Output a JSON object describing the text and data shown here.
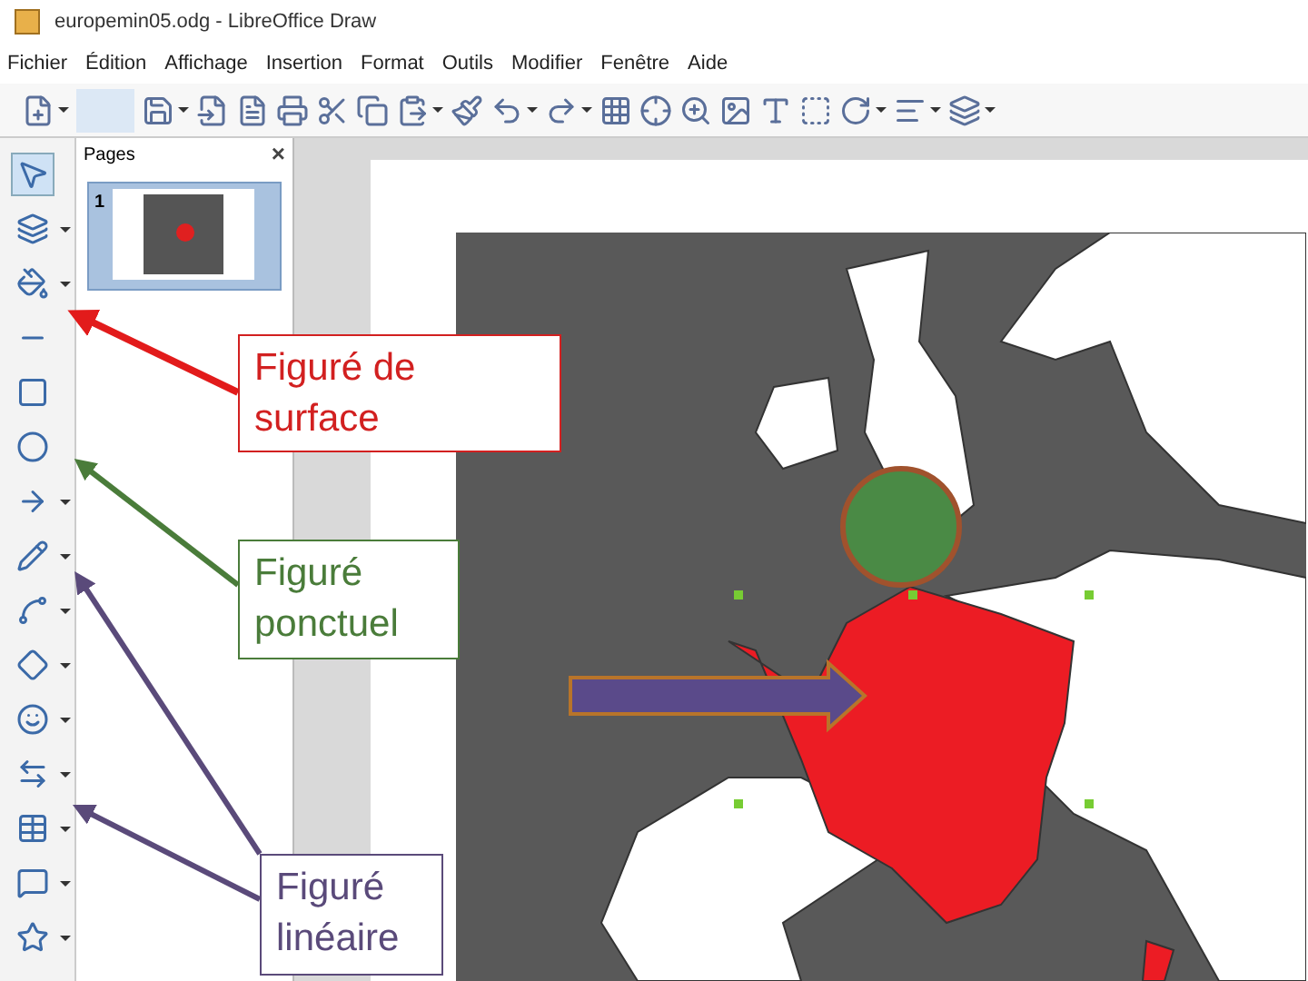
{
  "window": {
    "title": "europemin05.odg - LibreOffice Draw"
  },
  "menu": [
    "Fichier",
    "Édition",
    "Affichage",
    "Insertion",
    "Format",
    "Outils",
    "Modifier",
    "Fenêtre",
    "Aide"
  ],
  "toolbar": [
    {
      "dropdown": true
    },
    {
      "dropdown": false
    },
    {
      "dropdown": true
    },
    {
      "dropdown": false
    },
    {
      "dropdown": false
    },
    {
      "dropdown": false
    },
    {
      "dropdown": false
    },
    {
      "dropdown": false
    },
    {
      "dropdown": true
    },
    {
      "dropdown": false
    },
    {
      "dropdown": true
    },
    {
      "dropdown": true
    },
    {
      "dropdown": false
    },
    {
      "dropdown": false
    },
    {
      "dropdown": false
    },
    {
      "dropdown": false
    },
    {
      "dropdown": false
    },
    {
      "dropdown": false
    },
    {
      "dropdown": true
    },
    {
      "dropdown": true
    },
    {
      "dropdown": true
    }
  ],
  "side_tools": [
    {
      "selected": true,
      "dropdown": false
    },
    {
      "selected": false,
      "dropdown": true
    },
    {
      "selected": false,
      "dropdown": true
    },
    {
      "selected": false,
      "dropdown": false
    },
    {
      "selected": false,
      "dropdown": false
    },
    {
      "selected": false,
      "dropdown": false
    },
    {
      "selected": false,
      "dropdown": true
    },
    {
      "selected": false,
      "dropdown": true
    },
    {
      "selected": false,
      "dropdown": true
    },
    {
      "selected": false,
      "dropdown": true
    },
    {
      "selected": false,
      "dropdown": true
    },
    {
      "selected": false,
      "dropdown": true
    },
    {
      "selected": false,
      "dropdown": true
    },
    {
      "selected": false,
      "dropdown": true
    },
    {
      "selected": false,
      "dropdown": true
    }
  ],
  "pages_panel": {
    "title": "Pages",
    "close": "×",
    "pages": [
      {
        "number": "1",
        "selected": true
      }
    ]
  },
  "callouts": [
    {
      "text": "Figuré  de surface",
      "color": "#d22020"
    },
    {
      "text": "Figuré ponctuel",
      "color": "#4a7c3a"
    },
    {
      "text": "Figuré linéaire",
      "color": "#5a4a7a"
    }
  ]
}
